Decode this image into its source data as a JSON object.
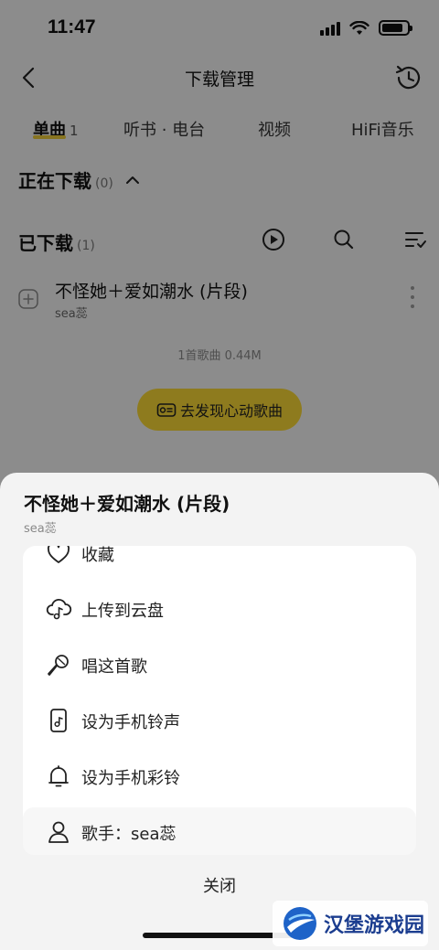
{
  "status_bar": {
    "time": "11:47"
  },
  "nav": {
    "title": "下载管理",
    "back_icon": "chevron-left-icon",
    "history_icon": "history-clock-icon"
  },
  "tabs": [
    {
      "label": "单曲",
      "count": "1",
      "active": true
    },
    {
      "label": "听书 · 电台",
      "count": ""
    },
    {
      "label": "视频",
      "count": ""
    },
    {
      "label": "HiFi音乐",
      "count": ""
    }
  ],
  "downloading": {
    "title": "正在下载",
    "count": "(0)"
  },
  "downloaded": {
    "title": "已下载",
    "count": "(1)"
  },
  "songs": [
    {
      "title": "不怪她＋爱如潮水 (片段)",
      "artist": "sea蕊"
    }
  ],
  "summary": "1首歌曲 0.44M",
  "discover_button": "去发现心动歌曲",
  "sheet": {
    "title": "不怪她＋爱如潮水 (片段)",
    "artist": "sea蕊",
    "menu": [
      {
        "label": "收藏",
        "icon": "heart-icon"
      },
      {
        "label": "上传到云盘",
        "icon": "cloud-upload-icon"
      },
      {
        "label": "唱这首歌",
        "icon": "microphone-icon"
      },
      {
        "label": "设为手机铃声",
        "icon": "phone-music-icon"
      },
      {
        "label": "设为手机彩铃",
        "icon": "bell-icon"
      }
    ],
    "singer": {
      "label": "歌手：sea蕊",
      "icon": "person-icon"
    },
    "close": "关闭"
  },
  "watermark": "汉堡游戏园",
  "colors": {
    "accent": "#f5d435",
    "overlay": "rgba(0,0,0,0.42)"
  }
}
